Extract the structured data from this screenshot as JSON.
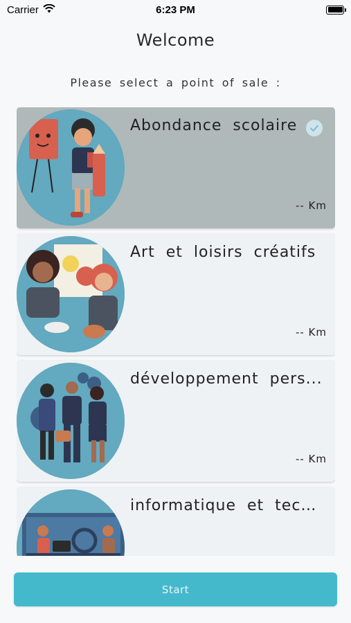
{
  "status_bar": {
    "carrier": "Carrier",
    "time": "6:23 PM",
    "battery_level": 1.0
  },
  "header": {
    "title": "Welcome",
    "subtitle": "Please select a point of sale :"
  },
  "points_of_sale": [
    {
      "name": "Abondance scolaire",
      "distance": "-- Km",
      "selected": true,
      "illustration": "school-supplies-illustration"
    },
    {
      "name": "Art et loisirs créatifs",
      "distance": "-- Km",
      "selected": false,
      "illustration": "art-painting-illustration"
    },
    {
      "name": "développement pers...",
      "distance": "-- Km",
      "selected": false,
      "illustration": "personal-development-illustration"
    },
    {
      "name": "informatique et techn...",
      "distance": "",
      "selected": false,
      "illustration": "computer-tech-illustration"
    }
  ],
  "footer": {
    "start_label": "Start"
  },
  "colors": {
    "accent": "#45b9cc",
    "selected_card": "#afb9b9",
    "card": "#eef2f4",
    "illustration_bg": "#63a9bf"
  }
}
